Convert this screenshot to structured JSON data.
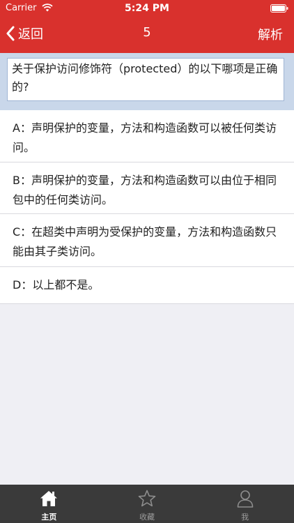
{
  "status_bar": {
    "carrier": "Carrier",
    "time": "5:24 PM"
  },
  "nav": {
    "back_label": "返回",
    "title": "5",
    "explain_label": "解析"
  },
  "question": {
    "text": "关于保护访问修饰符（protected）的以下哪项是正确的?"
  },
  "options": [
    {
      "text": "A：声明保护的变量，方法和构造函数可以被任何类访问。"
    },
    {
      "text": "B：声明保护的变量，方法和构造函数可以由位于相同包中的任何类访问。"
    },
    {
      "text": "C：在超类中声明为受保护的变量，方法和构造函数只能由其子类访问。"
    },
    {
      "text": "D：以上都不是。"
    }
  ],
  "tabs": [
    {
      "label": "主页",
      "icon": "home-icon",
      "active": true
    },
    {
      "label": "收藏",
      "icon": "star-icon",
      "active": false
    },
    {
      "label": "我",
      "icon": "person-icon",
      "active": false
    }
  ],
  "colors": {
    "brand": "#d9312d",
    "question_band": "#c9d7ea",
    "tabbar": "#3a3a3a"
  }
}
